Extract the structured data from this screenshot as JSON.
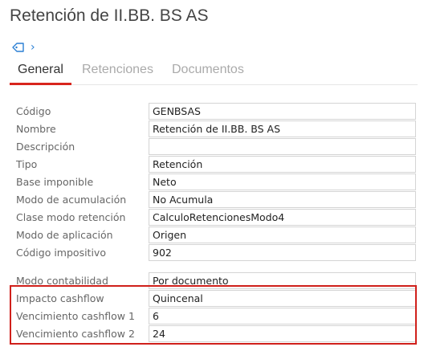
{
  "page": {
    "title": "Retención de II.BB. BS AS"
  },
  "tabs": [
    {
      "label": "General",
      "active": true
    },
    {
      "label": "Retenciones",
      "active": false
    },
    {
      "label": "Documentos",
      "active": false
    }
  ],
  "fields": [
    {
      "label": "Código",
      "value": "GENBSAS"
    },
    {
      "label": "Nombre",
      "value": "Retención de II.BB. BS AS"
    },
    {
      "label": "Descripción",
      "value": ""
    },
    {
      "label": "Tipo",
      "value": "Retención"
    },
    {
      "label": "Base imponible",
      "value": "Neto"
    },
    {
      "label": "Modo de acumulación",
      "value": "No Acumula"
    },
    {
      "label": "Clase modo retención",
      "value": "CalculoRetencionesModo4"
    },
    {
      "label": "Modo de aplicación",
      "value": "Origen"
    },
    {
      "label": "Código impositivo",
      "value": "902"
    },
    {
      "label": "Modo contabilidad",
      "value": "Por documento"
    },
    {
      "label": "Impacto cashflow",
      "value": "Quincenal"
    },
    {
      "label": "Vencimiento cashflow 1",
      "value": "6"
    },
    {
      "label": "Vencimiento cashflow 2",
      "value": "24"
    }
  ],
  "colors": {
    "accent": "#d8251d",
    "highlight": "#d0201b",
    "icon": "#2a7fd4"
  },
  "icons": [
    "tag-icon",
    "chevron-right-icon"
  ]
}
